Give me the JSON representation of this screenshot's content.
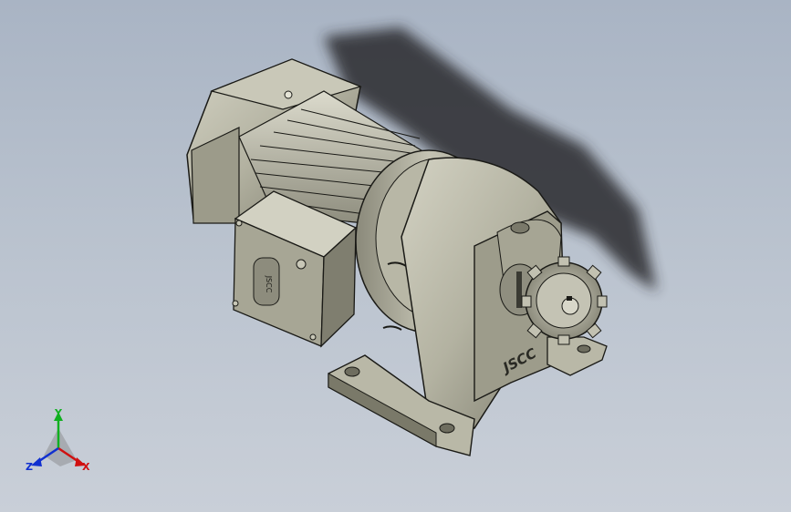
{
  "viewport": {
    "part_markings": {
      "gear_housing_logo": "JSCC",
      "terminal_box_label": "JSCC"
    },
    "triad": {
      "x_label": "X",
      "y_label": "Y",
      "z_label": "Z",
      "x_color": "#d01010",
      "y_color": "#10b020",
      "z_color": "#1030d0"
    }
  },
  "colors": {
    "background_top": "#a9b4c4",
    "background_bottom": "#c9cfd8",
    "body_light": "#c9c8b8",
    "body_mid": "#a9a897",
    "body_dark": "#6f6e60",
    "edge": "#1a1a16",
    "shadow": "#2b2c2e"
  }
}
